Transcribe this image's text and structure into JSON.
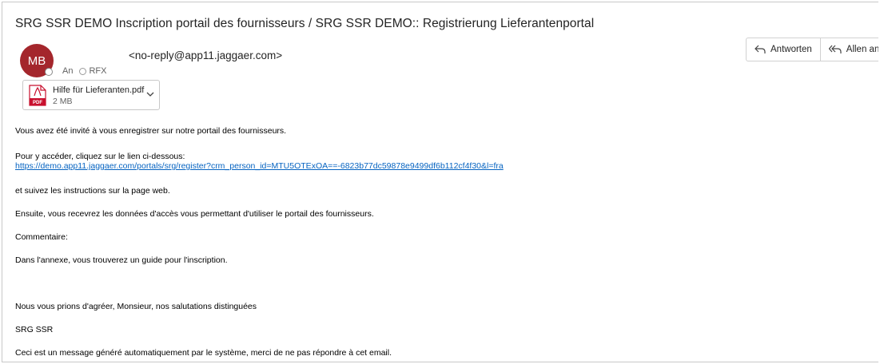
{
  "email": {
    "subject": "SRG SSR DEMO  Inscription portail des fournisseurs / SRG SSR DEMO:: Registrierung Lieferantenportal",
    "sender": {
      "initials": "MB",
      "address": "<no-reply@app11.jaggaer.com>",
      "avatar_color": "#a4262c"
    },
    "recipients": {
      "to_label": "An",
      "to_name": "RFX"
    },
    "actions": {
      "reply_label": "Antworten",
      "reply_all_label": "Allen antwo"
    },
    "attachment": {
      "icon": "pdf-icon",
      "name": "Hilfe für Lieferanten.pdf",
      "size": "2 MB"
    },
    "body": {
      "intro": "Vous avez été invité à vous enregistrer sur notre portail des fournisseurs.",
      "access": "Pour y accéder, cliquez sur le lien ci-dessous:",
      "link": "https://demo.app11.jaggaer.com/portals/srg/register?crm_person_id=MTU5OTExOA==-6823b77dc59878e9499df6b112cf4f30&l=fra",
      "instructions": "et suivez les instructions sur la page web.",
      "credentials": "Ensuite, vous recevrez les données d'accès vous permettant d'utiliser le portail des fournisseurs.",
      "comment_label": "Commentaire:",
      "annex": "Dans l'annexe, vous trouverez un guide pour l'inscription.",
      "greeting": "Nous vous prions d'agréer, Monsieur, nos salutations distinguées",
      "signature": "SRG SSR",
      "footer": "Ceci est un message généré automatiquement par le système, merci de ne pas répondre à cet email."
    }
  },
  "colors": {
    "link": "#0563c1",
    "accent": "#a4262c",
    "pdf_red": "#c8102e"
  }
}
